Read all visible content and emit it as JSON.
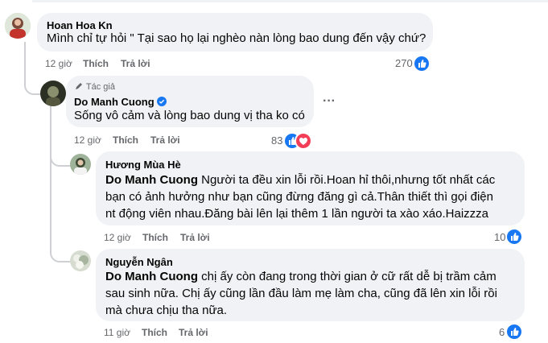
{
  "comments": [
    {
      "author": "Hoan Hoa Kn",
      "text": "Mình chỉ tự hỏi \" Tại sao họ lại nghèo nàn lòng bao dung đến vậy chứ?",
      "time": "12 giờ",
      "like_label": "Thích",
      "reply_label": "Trả lời",
      "reaction_count": "270"
    },
    {
      "author_badge": "Tác giả",
      "author": "Do Manh Cuong",
      "text": "Sống vô cảm và lòng bao dung vị tha ko có",
      "time": "12 giờ",
      "like_label": "Thích",
      "reply_label": "Trả lời",
      "reaction_count": "83",
      "more_label": "···"
    },
    {
      "author": "Hương Mùa Hè",
      "mention": "Do Manh Cuong",
      "text": " Người ta đều xin lỗi rồi.Hoan hỉ thôi,nhưng tốt nhất các bạn có ảnh hưởng như bạn cũng đừng đăng gì cả.Thân thiết thì gọi điện nt động viên nhau.Đăng bài lên lại thêm 1 lần người ta xào xáo.Haizzza",
      "time": "12 giờ",
      "like_label": "Thích",
      "reply_label": "Trả lời",
      "reaction_count": "10"
    },
    {
      "author": "Nguyễn Ngân",
      "mention": "Do Manh Cuong",
      "text": " chị ấy còn đang trong thời gian ở cữ rất dễ bị trầm cảm sau sinh nữa. Chị ấy cũng lần đầu làm mẹ làm cha, cũng đã lên xin lỗi rồi mà chưa chịu tha nữa.",
      "time": "11 giờ",
      "like_label": "Thích",
      "reply_label": "Trả lời",
      "reaction_count": "6"
    }
  ],
  "colors": {
    "bubble": "#f0f2f5",
    "like_blue": "#1877f2",
    "heart_red": "#f33e58",
    "meta_gray": "#65676b"
  },
  "icons": [
    "like-icon",
    "heart-icon",
    "pencil-icon",
    "verified-badge-icon",
    "more-options-icon"
  ]
}
